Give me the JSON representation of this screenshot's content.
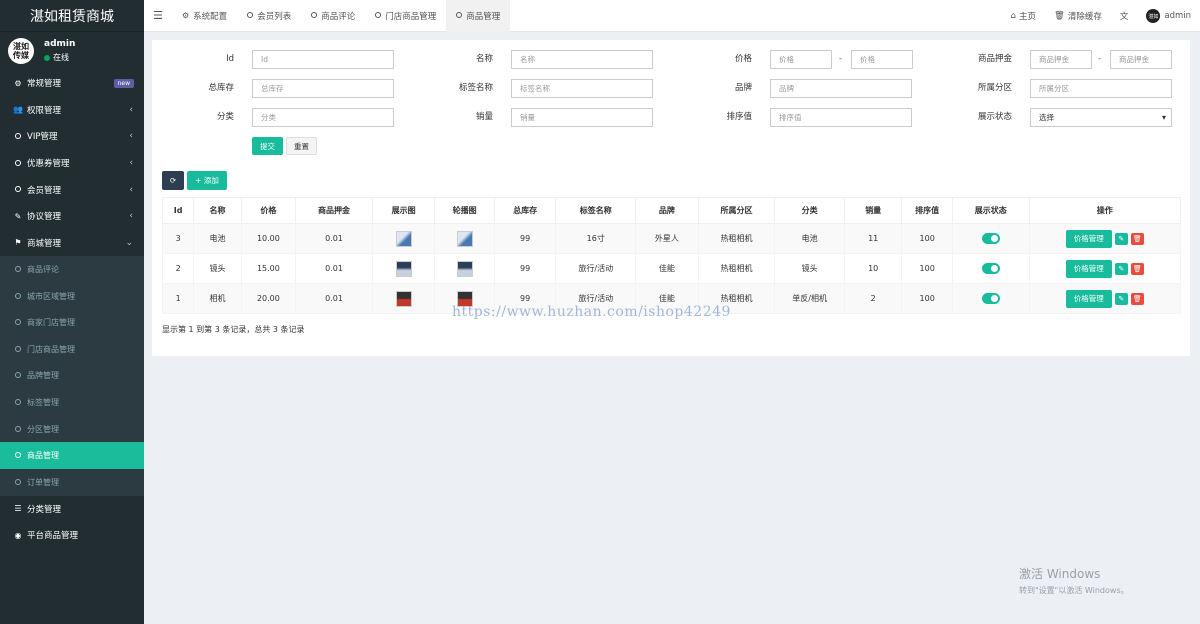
{
  "app": {
    "title": "湛如租赁商城"
  },
  "user": {
    "avatar_text": "湛如传媒",
    "name": "admin",
    "status": "在线"
  },
  "sidebar": {
    "items": [
      {
        "label": "常规管理",
        "icon": "cogs-icon",
        "badge": "new"
      },
      {
        "label": "权限管理",
        "icon": "users-icon",
        "arrow": "‹"
      },
      {
        "label": "VIP管理",
        "icon": "circle-icon",
        "arrow": "‹"
      },
      {
        "label": "优惠券管理",
        "icon": "circle-icon",
        "arrow": "‹"
      },
      {
        "label": "会员管理",
        "icon": "circle-icon",
        "arrow": "‹"
      },
      {
        "label": "协议管理",
        "icon": "magic-icon",
        "arrow": "‹"
      },
      {
        "label": "商城管理",
        "icon": "flag-icon",
        "arrow": "⌄"
      }
    ],
    "subitems": [
      {
        "label": "商品评论"
      },
      {
        "label": "城市区域管理"
      },
      {
        "label": "商家门店管理"
      },
      {
        "label": "门店商品管理"
      },
      {
        "label": "品牌管理"
      },
      {
        "label": "标签管理"
      },
      {
        "label": "分区管理"
      },
      {
        "label": "商品管理",
        "active": true
      },
      {
        "label": "订单管理"
      },
      {
        "label": "分类管理",
        "icon": "list-icon"
      },
      {
        "label": "平台商品管理",
        "icon": "globe-icon"
      }
    ]
  },
  "topbar": {
    "tabs": [
      {
        "label": "系统配置",
        "icon": "gear-icon"
      },
      {
        "label": "会员列表",
        "icon": "circle-icon"
      },
      {
        "label": "商品评论",
        "icon": "circle-icon"
      },
      {
        "label": "门店商品管理",
        "icon": "circle-icon"
      },
      {
        "label": "商品管理",
        "icon": "circle-icon",
        "active": true
      }
    ],
    "home": "主页",
    "clear_cache": "清除缓存",
    "user": "admin"
  },
  "form": {
    "fields": [
      {
        "label": "Id",
        "placeholder": "Id"
      },
      {
        "label": "名称",
        "placeholder": "名称"
      },
      {
        "label": "价格",
        "placeholder1": "价格",
        "placeholder2": "价格"
      },
      {
        "label": "商品押金",
        "placeholder1": "商品押金",
        "placeholder2": "商品押金"
      },
      {
        "label": "总库存",
        "placeholder": "总库存"
      },
      {
        "label": "标签名称",
        "placeholder": "标签名称"
      },
      {
        "label": "品牌",
        "placeholder": "品牌"
      },
      {
        "label": "所属分区",
        "placeholder": "所属分区"
      },
      {
        "label": "分类",
        "placeholder": "分类"
      },
      {
        "label": "销量",
        "placeholder": "销量"
      },
      {
        "label": "排序值",
        "placeholder": "排序值"
      },
      {
        "label": "展示状态",
        "value": "选择"
      }
    ],
    "dash": "-",
    "submit": "提交",
    "reset": "重置"
  },
  "toolbar": {
    "refresh_icon": "refresh-icon",
    "add": "+ 添加"
  },
  "table": {
    "headers": [
      "Id",
      "名称",
      "价格",
      "商品押金",
      "展示图",
      "轮播图",
      "总库存",
      "标签名称",
      "品牌",
      "所属分区",
      "分类",
      "销量",
      "排序值",
      "展示状态",
      "操作"
    ],
    "rows": [
      {
        "id": "3",
        "name": "电池",
        "price": "10.00",
        "deposit": "0.01",
        "img": "a",
        "stock": "99",
        "tag": "16寸",
        "brand": "外星人",
        "zone": "热租相机",
        "category": "电池",
        "sales": "11",
        "sort": "100"
      },
      {
        "id": "2",
        "name": "镜头",
        "price": "15.00",
        "deposit": "0.01",
        "img": "b",
        "stock": "99",
        "tag": "旅行/活动",
        "brand": "佳能",
        "zone": "热租相机",
        "category": "镜头",
        "sales": "10",
        "sort": "100"
      },
      {
        "id": "1",
        "name": "相机",
        "price": "20.00",
        "deposit": "0.01",
        "img": "c",
        "stock": "99",
        "tag": "旅行/活动",
        "brand": "佳能",
        "zone": "热租相机",
        "category": "单反/相机",
        "sales": "2",
        "sort": "100"
      }
    ],
    "op_label": "价格管理"
  },
  "pager": {
    "info": "显示第 1 到第 3 条记录，总共 3 条记录"
  },
  "watermark": "https://www.huzhan.com/ishop42249",
  "windows": {
    "line1": "激活 Windows",
    "line2": "转到\"设置\"以激活 Windows。"
  }
}
